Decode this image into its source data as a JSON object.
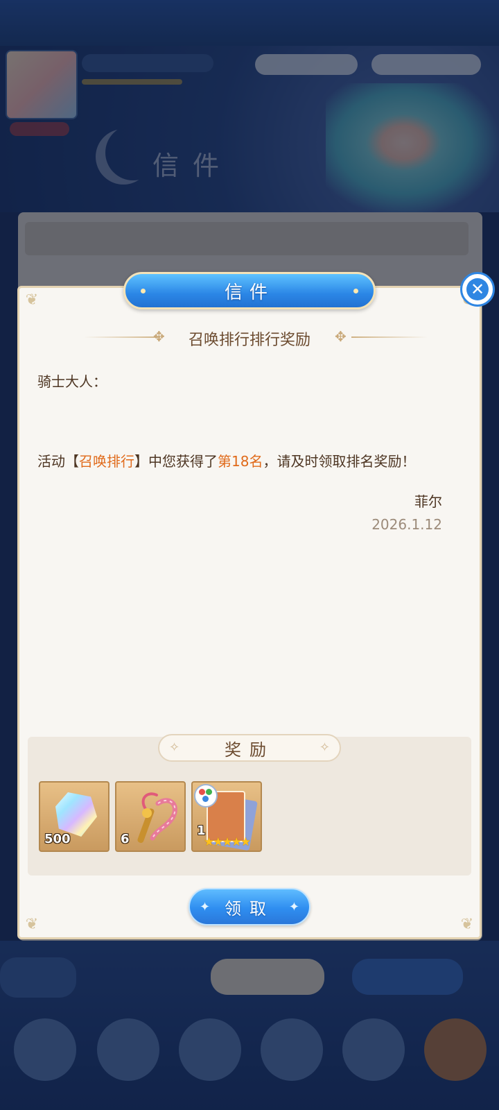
{
  "dialog": {
    "header_title": "信件",
    "close_icon": "close-icon",
    "subject": "召唤排行排行奖励",
    "greeting": "骑士大人：",
    "body": {
      "part1": "活动",
      "bracket_open": "【",
      "event_name": "召唤排行",
      "bracket_close": "】",
      "part2": "中您获得了",
      "rank": "第18名",
      "part3": "，请及时领取排名奖励！"
    },
    "sender": "菲尔",
    "date": "2026.1.12",
    "rewards_title": "奖励",
    "rewards": [
      {
        "icon": "crystal-gem-icon",
        "count": "500"
      },
      {
        "icon": "magic-wand-icon",
        "count": "6"
      },
      {
        "icon": "character-card-icon",
        "count": "1",
        "stars": "★★★★★"
      }
    ],
    "claim_label": "领取"
  },
  "colors": {
    "accent_blue": "#2f86e2",
    "highlight_orange": "#e06a1a",
    "text_brown": "#4d3522"
  }
}
